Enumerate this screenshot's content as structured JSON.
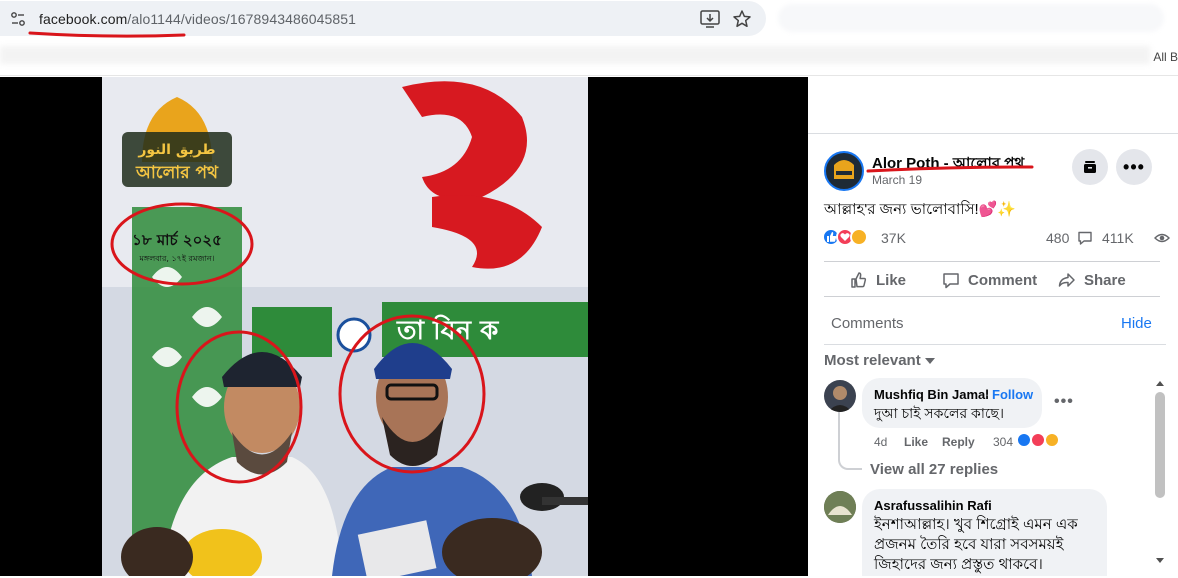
{
  "browser": {
    "url_host": "facebook.com",
    "url_path": "/alo1144/videos/1678943486045851",
    "bookmarks_right": "All B"
  },
  "video": {
    "banner_logo_arabic": "طريق النور",
    "banner_logo_bengali": "আলোর পথ",
    "banner_date_line1": "১৮ মার্চ ২০২৫",
    "banner_date_line2": "মঙ্গলবার, ১৭ই রমজান।",
    "banner_green_text": "তা যিন ক"
  },
  "post": {
    "page_name": "Alor Poth - আলোর পথ",
    "date": "March 19",
    "text": "আল্লাহ'র জন্য ভালোবাসি!💕✨",
    "reaction_count": "37K",
    "comment_count": "480",
    "view_count": "411K",
    "actions": {
      "like": "Like",
      "comment": "Comment",
      "share": "Share"
    }
  },
  "comments_panel": {
    "header": "Comments",
    "hide": "Hide",
    "sort": "Most relevant",
    "items": [
      {
        "author": "Mushfiq Bin Jamal",
        "follow": "Follow",
        "text": "দুআ চাই সকলের কাছে।",
        "time": "4d",
        "like": "Like",
        "reply": "Reply",
        "reactions": "304",
        "view_replies": "View all 27 replies"
      },
      {
        "author": "Asrafussalihin Rafi",
        "text_lines": [
          "ইনশাআল্লাহ। খুব শিগ্রোই এমন এক",
          "প্রজনম তৈরি হবে যারা সবসময়ই",
          "জিহাদের জন্য প্রস্তুত থাকবে।"
        ]
      }
    ]
  },
  "colors": {
    "facebook_blue": "#1877f2",
    "annotation_red": "#d9151b",
    "banner_red": "#d71920",
    "banner_green": "#2e8b3a"
  }
}
